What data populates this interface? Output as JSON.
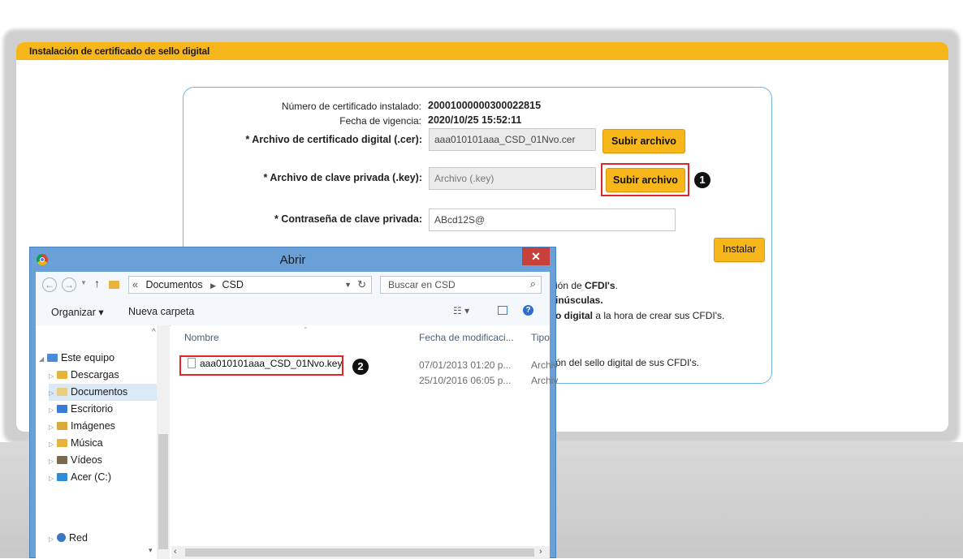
{
  "header": {
    "title": "Instalación de certificado de sello digital"
  },
  "cert_info": {
    "num_label": "Número de certificado instalado:",
    "num_value": "20001000000300022815",
    "fecha_label": "Fecha de vigencia:",
    "fecha_value": "2020/10/25 15:52:11"
  },
  "form": {
    "cer_label": "* Archivo de certificado digital (.cer):",
    "cer_value": "aaa010101aaa_CSD_01Nvo.cer",
    "cer_button": "Subir archivo",
    "key_label": "* Archivo de clave privada (.key):",
    "key_placeholder": "Archivo (.key)",
    "key_button": "Subir archivo",
    "pwd_label": "* Contraseña de clave privada:",
    "pwd_value": "ABcd12S@",
    "install_button": "Instalar"
  },
  "info_lines": {
    "l1_a": "ión de ",
    "l1_b": "CFDI's",
    "l2": "inúsculas",
    "l3_b": "o digital",
    "l3_a": " a la hora de crear sus CFDI's.",
    "l4": "ón del sello digital de sus CFDI's."
  },
  "steps": {
    "one": "1",
    "two": "2"
  },
  "dialog": {
    "title": "Abrir",
    "close": "✕",
    "path_prefix": "«",
    "path": [
      "Documentos",
      "CSD"
    ],
    "search_placeholder": "Buscar en CSD",
    "organize": "Organizar ▾",
    "new_folder": "Nueva carpeta",
    "tree": [
      {
        "label": "Este equipo"
      },
      {
        "label": "Descargas"
      },
      {
        "label": "Documentos"
      },
      {
        "label": "Escritorio"
      },
      {
        "label": "Imágenes"
      },
      {
        "label": "Música"
      },
      {
        "label": "Vídeos"
      },
      {
        "label": "Acer (C:)"
      },
      {
        "label": "Red"
      }
    ],
    "columns": {
      "name": "Nombre",
      "date": "Fecha de modificaci...",
      "type": "Tipo"
    },
    "files": [
      {
        "name": "aaa010101aaa_CSD_01Nvo.key",
        "date": "07/01/2013 01:20 p...",
        "type": "Archiv"
      },
      {
        "name": "",
        "date": "25/10/2016 06:05 p...",
        "type": "Archiv"
      }
    ]
  },
  "colors": {
    "accent": "#f7b71b",
    "highlight": "#e0262b",
    "frame": "#6fb6e0"
  }
}
